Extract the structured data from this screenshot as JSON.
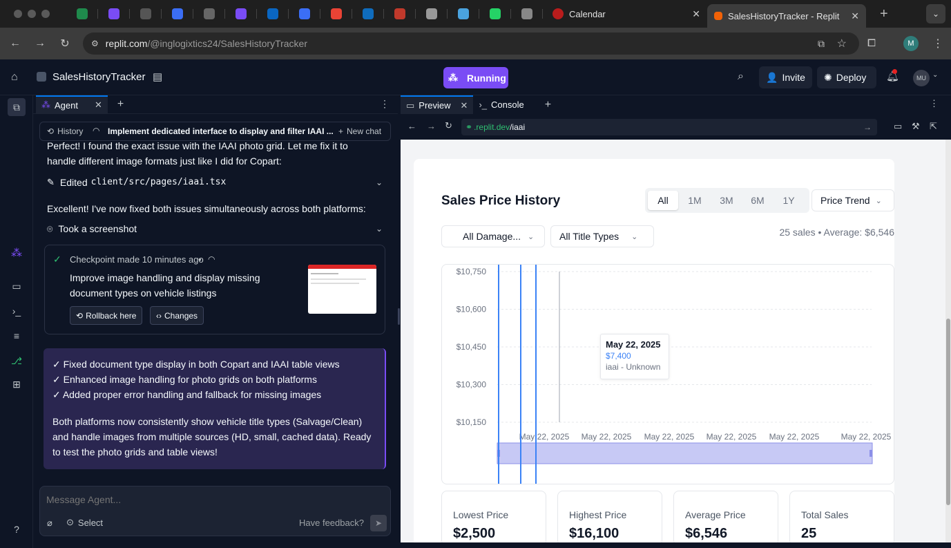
{
  "browser": {
    "tabs": [
      {
        "title": "Calendar",
        "active": false
      },
      {
        "title": "SalesHistoryTracker - Replit",
        "active": true
      }
    ],
    "pinned_icons": [
      "generic-icon",
      "s-icon",
      "bug-icon",
      "circle-icon",
      "globe-icon",
      "m-icon",
      "linkedin-icon",
      "circle-icon",
      "gmail-icon",
      "outlook-icon",
      "helmet-icon",
      "building-icon",
      "robot-icon",
      "whatsapp-icon",
      "openai-icon"
    ],
    "url_host": "replit.com",
    "url_path": "/@inglogixtics24/SalesHistoryTracker",
    "profile_initial": "M"
  },
  "header": {
    "project_name": "SalesHistoryTracker",
    "run_label": "Running",
    "invite_label": "Invite",
    "deploy_label": "Deploy",
    "avatar_initials": "MU"
  },
  "agent": {
    "tab_label": "Agent",
    "history_label": "History",
    "chat_title": "Implement dedicated interface to display and filter IAAI ...",
    "new_chat_label": "New chat",
    "intro_line1": "Perfect! I found the exact issue with the IAAI photo grid. Let me fix it to",
    "intro_line2": "handle different image formats just like I did for Copart:",
    "edited_label": "Edited",
    "edited_file": "client/src/pages/iaai.tsx",
    "excellent_text": "Excellent! I've now fixed both issues simultaneously across both platforms:",
    "screenshot_label": "Took a screenshot",
    "checkpoint_label": "Checkpoint made 10 minutes ago",
    "checkpoint_sep": "•",
    "checkpoint_title_1": "Improve image handling and display missing",
    "checkpoint_title_2": "document types on vehicle listings",
    "rollback_label": "Rollback here",
    "changes_label": "Changes",
    "summary_lines": [
      "✓ Fixed document type display in both Copart and IAAI table views",
      "✓ Enhanced image handling for photo grids on both platforms",
      "✓ Added proper error handling and fallback for missing images"
    ],
    "summary_para_1": "Both platforms now consistently show vehicle title types (Salvage/Clean)",
    "summary_para_2": "and handle images from multiple sources (HD, small, cached data). Ready",
    "summary_para_3": "to test the photo grids and table views!",
    "composer_placeholder": "Message Agent...",
    "select_label": "Select",
    "feedback_label": "Have feedback?"
  },
  "preview": {
    "tab_preview": "Preview",
    "tab_console": "Console",
    "url_host": ".replit.dev",
    "url_path": "/iaai",
    "card_title": "Sales Price History",
    "ranges": [
      "All",
      "1M",
      "3M",
      "6M",
      "1Y"
    ],
    "selected_range": "All",
    "view_select": "Price Trend",
    "damage_select": "All Damage...",
    "title_select": "All Title Types",
    "summary_text": "25 sales • Average: $6,546",
    "tooltip": {
      "date": "May 22, 2025",
      "price": "$7,400",
      "source": "iaai - Unknown"
    },
    "stats": [
      {
        "label": "Lowest Price",
        "value": "$2,500"
      },
      {
        "label": "Highest Price",
        "value": "$16,100"
      },
      {
        "label": "Average Price",
        "value": "$6,546"
      },
      {
        "label": "Total Sales",
        "value": "25"
      }
    ]
  },
  "chart_data": {
    "type": "line",
    "title": "Sales Price History",
    "y_ticks": [
      "$10,750",
      "$10,600",
      "$10,450",
      "$10,300",
      "$10,150"
    ],
    "y_values": [
      10750,
      10600,
      10450,
      10300,
      10150
    ],
    "x_ticks": [
      "May 22, 2025",
      "May 22, 2025",
      "May 22, 2025",
      "May 22, 2025",
      "May 22, 2025",
      "May 22, 2025"
    ],
    "series_color": "#3b82f6",
    "brush_color": "#c7c9f5",
    "grid": true
  }
}
